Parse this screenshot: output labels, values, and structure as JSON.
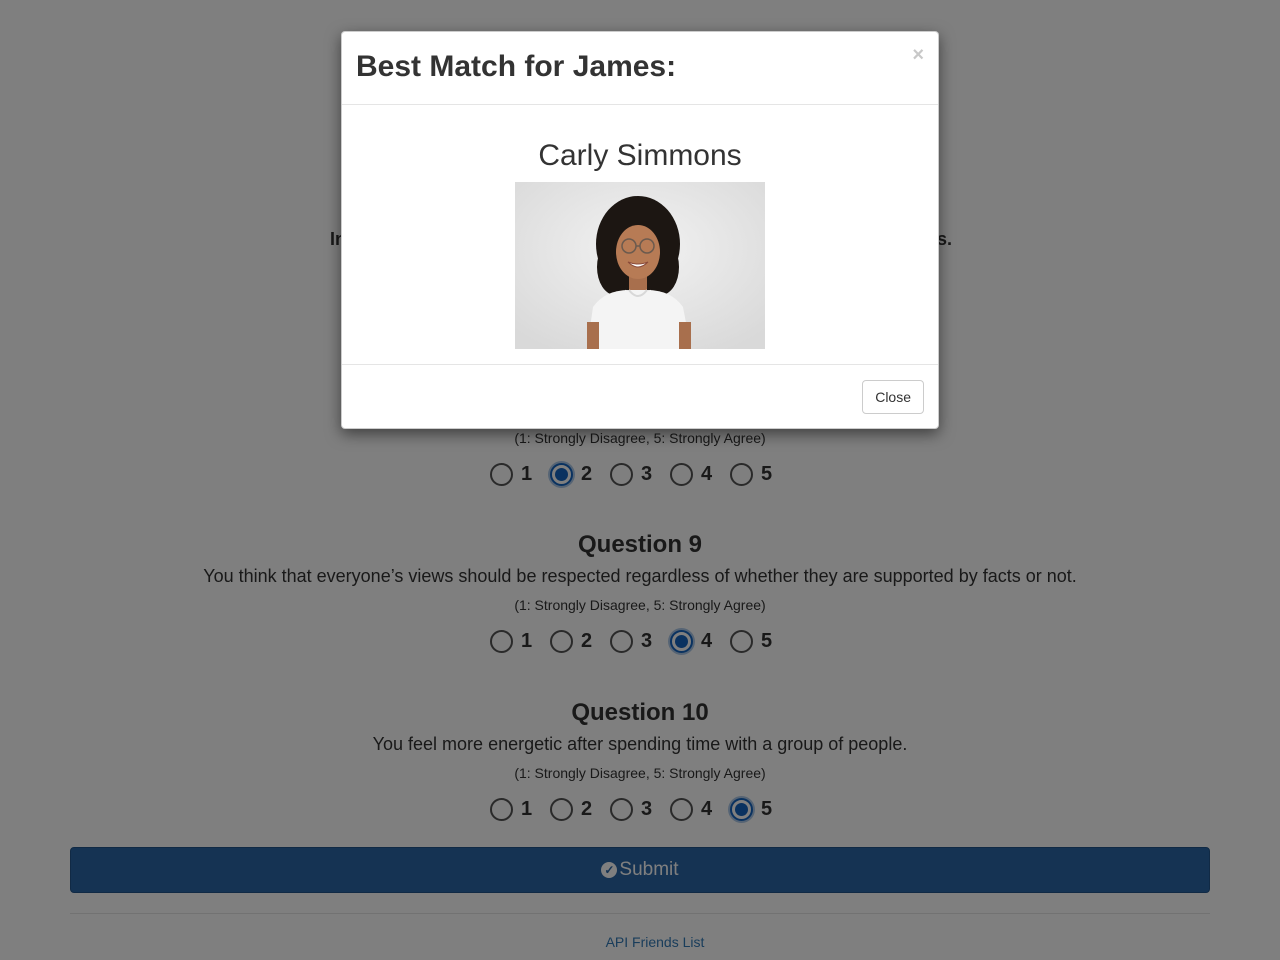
{
  "background": {
    "partial_left": "In",
    "partial_right": "s.",
    "questions": [
      {
        "title": "",
        "text": "",
        "scale": "(1: Strongly Disagree, 5: Strongly Agree)",
        "options": [
          "1",
          "2",
          "3",
          "4",
          "5"
        ],
        "selected": 2
      },
      {
        "title": "Question 9",
        "text": "You think that everyone’s views should be respected regardless of whether they are supported by facts or not.",
        "scale": "(1: Strongly Disagree, 5: Strongly Agree)",
        "options": [
          "1",
          "2",
          "3",
          "4",
          "5"
        ],
        "selected": 4
      },
      {
        "title": "Question 10",
        "text": "You feel more energetic after spending time with a group of people.",
        "scale": "(1: Strongly Disagree, 5: Strongly Agree)",
        "options": [
          "1",
          "2",
          "3",
          "4",
          "5"
        ],
        "selected": 5
      }
    ],
    "submit_label": "Submit",
    "submit_icon": "check-circle-icon",
    "footer_link": "API Friends List"
  },
  "modal": {
    "title": "Best Match for James:",
    "close_x": "×",
    "match_name": "Carly Simmons",
    "close_button": "Close"
  },
  "colors": {
    "primary": "#2a67a6",
    "radio_checked": "#1565c0",
    "link": "#337ab7"
  }
}
